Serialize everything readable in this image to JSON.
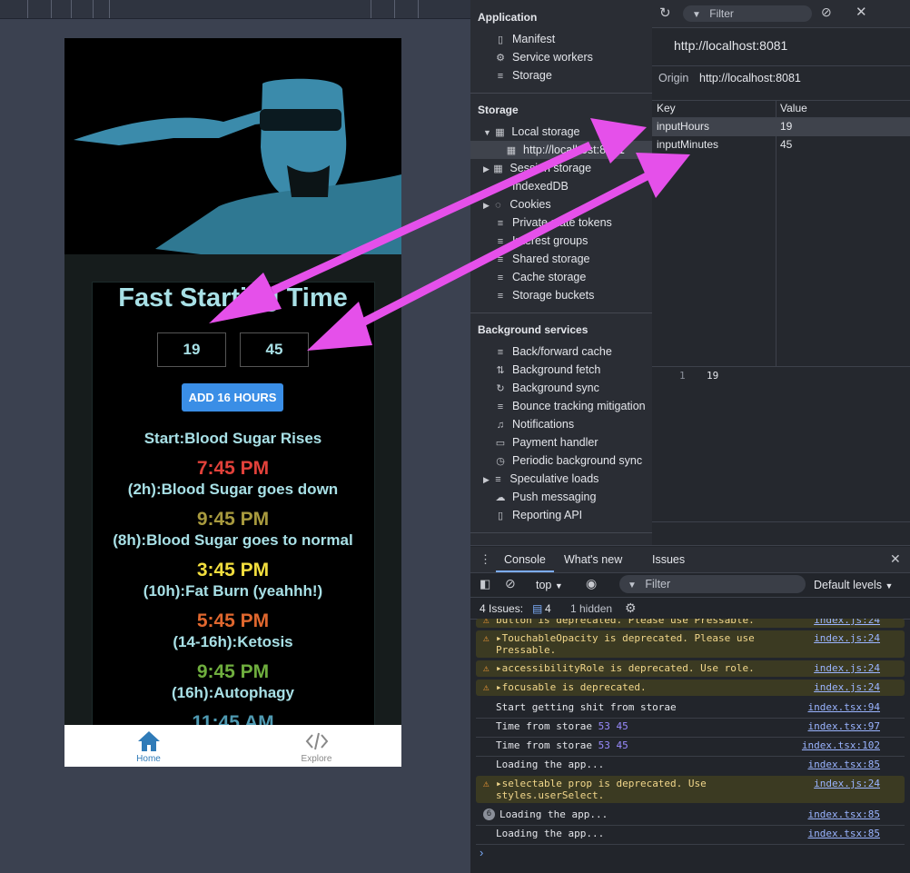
{
  "app": {
    "hero_alt": "Header portrait",
    "title": "Fast Starting Time",
    "input_hours": "19",
    "input_minutes": "45",
    "add_button": "ADD 16 HOURS",
    "start_label": "Start:Blood Sugar Rises",
    "milestones": [
      {
        "time": "7:45 PM",
        "label": "(2h):Blood Sugar goes down",
        "color": "#e2413a"
      },
      {
        "time": "9:45 PM",
        "label": "(8h):Blood Sugar goes to normal",
        "color": "#a89a3e"
      },
      {
        "time": "3:45 PM",
        "label": "(10h):Fat Burn (yeahhh!)",
        "color": "#f2de3e"
      },
      {
        "time": "5:45 PM",
        "label": "(14-16h):Ketosis",
        "color": "#e0672e"
      },
      {
        "time": "9:45 PM",
        "label": "(16h):Autophagy",
        "color": "#6fae3e"
      },
      {
        "time": "11:45 AM",
        "label": "",
        "color": "#4f9ab2"
      }
    ],
    "tabs": [
      {
        "label": "Home",
        "icon": "home-icon",
        "active": true
      },
      {
        "label": "Explore",
        "icon": "code-icon",
        "active": false
      }
    ]
  },
  "devtools": {
    "application_heading": "Application",
    "application_items": [
      "Manifest",
      "Service workers",
      "Storage"
    ],
    "storage_heading": "Storage",
    "storage_items": [
      "Local storage",
      "http://localhost:8081",
      "Session storage",
      "IndexedDB",
      "Cookies",
      "Private state tokens",
      "Interest groups",
      "Shared storage",
      "Cache storage",
      "Storage buckets"
    ],
    "background_heading": "Background services",
    "background_items": [
      "Back/forward cache",
      "Background fetch",
      "Background sync",
      "Bounce tracking mitigation",
      "Notifications",
      "Payment handler",
      "Periodic background sync",
      "Speculative loads",
      "Push messaging",
      "Reporting API"
    ],
    "filter_placeholder": "Filter",
    "origin_title": "http://localhost:8081",
    "origin_label": "Origin",
    "origin_value": "http://localhost:8081",
    "table_headers": [
      "Key",
      "Value"
    ],
    "rows": [
      {
        "key": "inputHours",
        "value": "19"
      },
      {
        "key": "inputMinutes",
        "value": "45"
      }
    ],
    "preview_line_no": "1",
    "preview_value": "19"
  },
  "console": {
    "tabs": [
      "Console",
      "What's new",
      "Issues"
    ],
    "context": "top",
    "filter_placeholder": "Filter",
    "levels": "Default levels",
    "issues_label": "4 Issues:",
    "issues_count": "4",
    "hidden_label": "1 hidden",
    "logs": [
      {
        "text": "button is deprecated. Please use Pressable.",
        "link": "index.js:24",
        "warn": true
      },
      {
        "text": "TouchableOpacity is deprecated. Please use Pressable.",
        "link": "index.js:24",
        "warn": true
      },
      {
        "text": "accessibilityRole is deprecated. Use role.",
        "link": "index.js:24",
        "warn": true
      },
      {
        "text": "focusable is deprecated.",
        "link": "index.js:24",
        "warn": true
      },
      {
        "text": "Start getting shit from storae",
        "link": "index.tsx:94",
        "warn": false
      },
      {
        "text": "Time from storae",
        "nums": "53 45",
        "link": "index.tsx:97",
        "warn": false
      },
      {
        "text": "Time from storae",
        "nums": "53 45",
        "link": "index.tsx:102",
        "warn": false
      },
      {
        "text": "Loading the app...",
        "link": "index.tsx:85",
        "warn": false
      },
      {
        "text": "selectable prop is deprecated. Use styles.userSelect.",
        "link": "index.js:24",
        "warn": true
      },
      {
        "text": "Loading the app...",
        "link": "index.tsx:85",
        "warn": false,
        "repeat": "6"
      },
      {
        "text": "Loading the app...",
        "link": "index.tsx:85",
        "warn": false
      }
    ]
  },
  "colors": {
    "accent": "#e550ea",
    "button": "#3a8ee6",
    "text_cyan": "#a8e0e6"
  }
}
